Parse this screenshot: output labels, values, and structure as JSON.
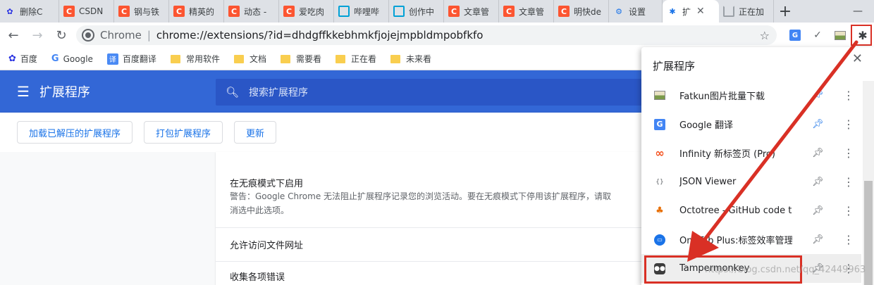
{
  "tabs": [
    {
      "label": "删除C",
      "favicon": "baidu"
    },
    {
      "label": "CSDN",
      "favicon": "csdn"
    },
    {
      "label": "钢与铁",
      "favicon": "csdn"
    },
    {
      "label": "精英的",
      "favicon": "csdn"
    },
    {
      "label": "动态 -",
      "favicon": "csdn"
    },
    {
      "label": "爱吃肉",
      "favicon": "csdn"
    },
    {
      "label": "哔哩哔",
      "favicon": "bilibili"
    },
    {
      "label": "创作中",
      "favicon": "bilibili"
    },
    {
      "label": "文章管",
      "favicon": "csdn"
    },
    {
      "label": "文章管",
      "favicon": "csdn"
    },
    {
      "label": "明快de",
      "favicon": "csdn"
    },
    {
      "label": "设置",
      "favicon": "gear"
    },
    {
      "label": "扩",
      "favicon": "puzzle",
      "active": true
    },
    {
      "label": "正在加",
      "favicon": "loading"
    }
  ],
  "tab_close": "✕",
  "new_tab": "+",
  "window": {
    "minimize": "—"
  },
  "toolbar": {
    "back": "←",
    "forward": "→",
    "reload": "↻",
    "url_scheme": "Chrome",
    "url_separator": "|",
    "url": "chrome://extensions/?id=dhdgffkkebhmkfjojejmpbldmpobfkfo",
    "star": "☆",
    "gt_icon": "G",
    "check": "✓",
    "puzzle": "✱"
  },
  "bookmarks": [
    {
      "label": "百度",
      "icon": "baidu"
    },
    {
      "label": "Google",
      "icon": "google"
    },
    {
      "label": "百度翻译",
      "icon": "fanyi"
    },
    {
      "label": "常用软件",
      "icon": "folder"
    },
    {
      "label": "文档",
      "icon": "folder"
    },
    {
      "label": "需要看",
      "icon": "folder"
    },
    {
      "label": "正在看",
      "icon": "folder"
    },
    {
      "label": "未来看",
      "icon": "folder"
    }
  ],
  "ext_page": {
    "title": "扩展程序",
    "search_placeholder": "搜索扩展程序",
    "buttons": [
      "加载已解压的扩展程序",
      "打包扩展程序",
      "更新"
    ],
    "rows": [
      {
        "label": "在无痕模式下启用",
        "desc": "警告：Google Chrome 无法阻止扩展程序记录您的浏览活动。要在无痕模式下停用该扩展程序，请取",
        "desc2": "消选中此选项。"
      },
      {
        "label": "允许访问文件网址"
      },
      {
        "label": "收集各项错误"
      }
    ]
  },
  "popup": {
    "title": "扩展程序",
    "close": "✕",
    "items": [
      {
        "name": "Fatkun图片批量下载",
        "pinned": true
      },
      {
        "name": "Google 翻译",
        "pinned": true
      },
      {
        "name": "Infinity 新标签页 (Pro)",
        "pinned": false
      },
      {
        "name": "JSON Viewer",
        "pinned": false
      },
      {
        "name": "Octotree - GitHub code tr...",
        "pinned": false
      },
      {
        "name": "OneTab Plus:标签效率管理...",
        "pinned": false
      },
      {
        "name": "Tampermonkey",
        "pinned": false,
        "hover": true
      }
    ],
    "more": "⋮"
  },
  "watermark": "https://blog.csdn.net/qq_42449963",
  "colors": {
    "accent": "#3367d6",
    "highlight": "#d93025"
  }
}
